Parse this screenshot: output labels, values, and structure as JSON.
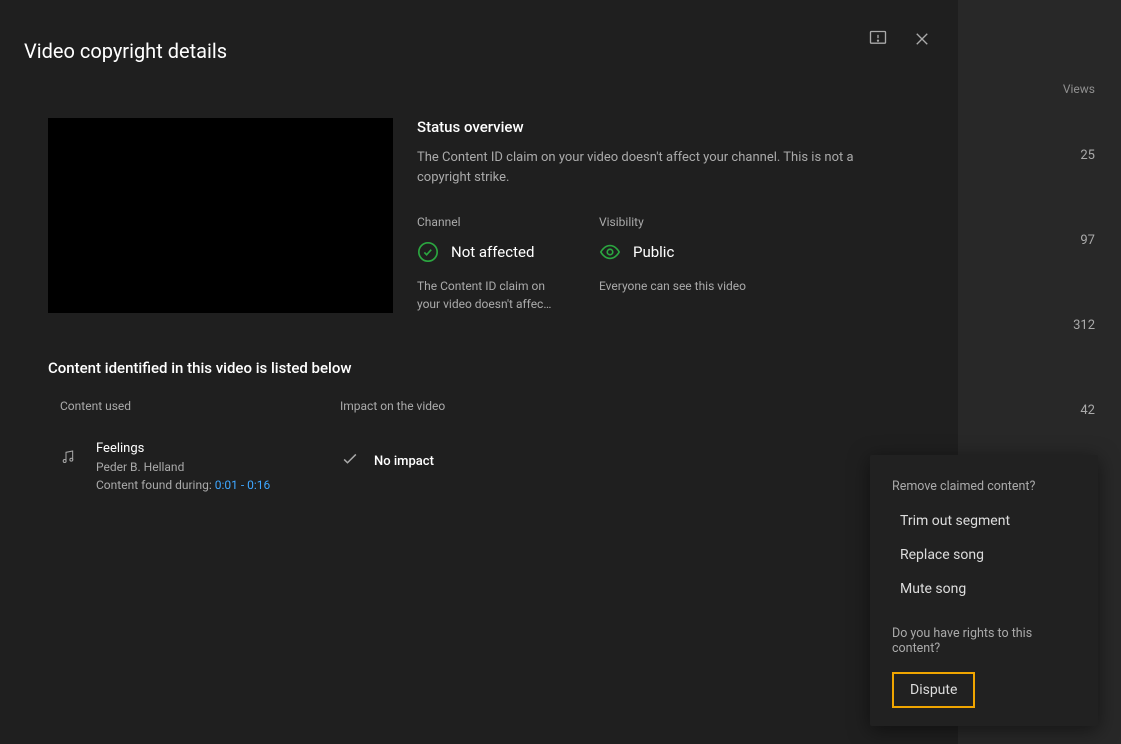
{
  "header": {
    "title": "Video copyright details"
  },
  "overview": {
    "title": "Status overview",
    "text": "The Content ID claim on your video doesn't affect your channel. This is not a copyright strike.",
    "channel": {
      "label": "Channel",
      "value": "Not affected",
      "desc": "The Content ID claim on your video doesn't affec…"
    },
    "visibility": {
      "label": "Visibility",
      "value": "Public",
      "desc": "Everyone can see this video"
    }
  },
  "section2": {
    "title": "Content identified in this video is listed below",
    "col_content": "Content used",
    "col_impact": "Impact on the video"
  },
  "claim": {
    "title": "Feelings",
    "artist": "Peder B. Helland",
    "found_prefix": "Content found during: ",
    "timestamps": "0:01 - 0:16",
    "impact": "No impact"
  },
  "popup": {
    "remove_label": "Remove claimed content?",
    "trim": "Trim out segment",
    "replace": "Replace song",
    "mute": "Mute song",
    "rights_label": "Do you have rights to this content?",
    "dispute": "Dispute"
  },
  "sidebar": {
    "views_header": "Views",
    "rows": [
      "25",
      "97",
      "312",
      "42"
    ]
  }
}
